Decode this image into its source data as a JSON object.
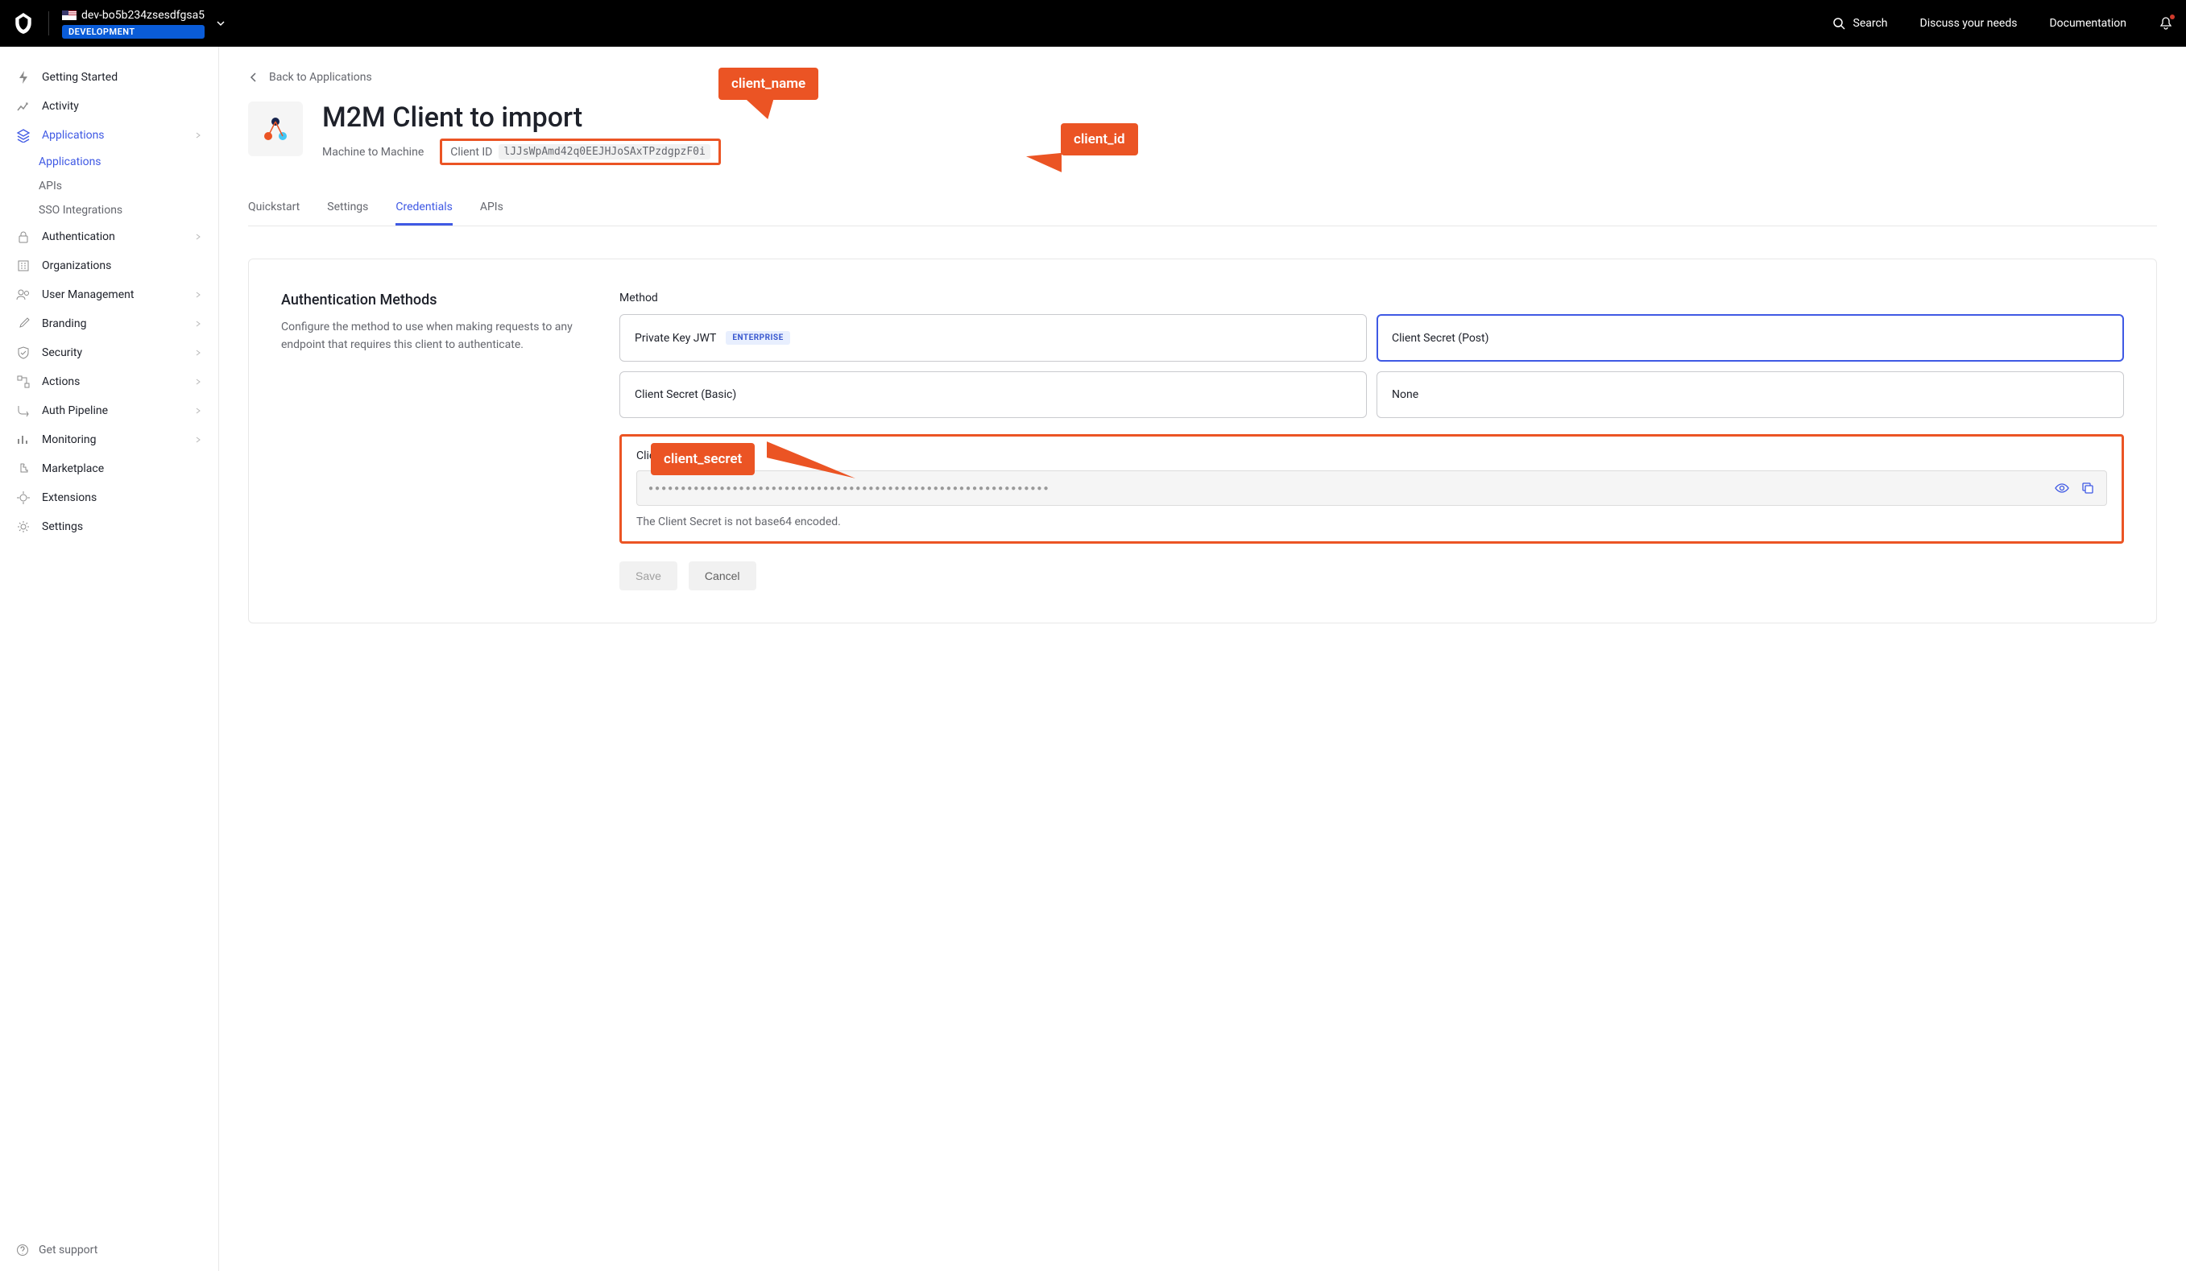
{
  "topbar": {
    "tenant_name": "dev-bo5b234zsesdfgsa5",
    "env_badge": "DEVELOPMENT",
    "search_label": "Search",
    "discuss_label": "Discuss your needs",
    "docs_label": "Documentation"
  },
  "sidebar": {
    "items": [
      {
        "label": "Getting Started",
        "icon": "bolt"
      },
      {
        "label": "Activity",
        "icon": "chart"
      },
      {
        "label": "Applications",
        "icon": "layers",
        "active": true,
        "expandable": true
      },
      {
        "label": "Authentication",
        "icon": "lock",
        "expandable": true
      },
      {
        "label": "Organizations",
        "icon": "building"
      },
      {
        "label": "User Management",
        "icon": "users",
        "expandable": true
      },
      {
        "label": "Branding",
        "icon": "brush",
        "expandable": true
      },
      {
        "label": "Security",
        "icon": "shield",
        "expandable": true
      },
      {
        "label": "Actions",
        "icon": "flow",
        "expandable": true
      },
      {
        "label": "Auth Pipeline",
        "icon": "pipe",
        "expandable": true
      },
      {
        "label": "Monitoring",
        "icon": "bars",
        "expandable": true
      },
      {
        "label": "Marketplace",
        "icon": "puzzle"
      },
      {
        "label": "Extensions",
        "icon": "plug"
      },
      {
        "label": "Settings",
        "icon": "gear"
      }
    ],
    "sub_applications": [
      {
        "label": "Applications",
        "active": true
      },
      {
        "label": "APIs"
      },
      {
        "label": "SSO Integrations"
      }
    ],
    "support_label": "Get support"
  },
  "page": {
    "back_label": "Back to Applications",
    "app_name": "M2M Client to import",
    "app_type": "Machine to Machine",
    "client_id_label": "Client ID",
    "client_id_value": "lJJsWpAmd42q0EEJHJoSAxTPzdgpzF0i",
    "tabs": [
      {
        "label": "Quickstart"
      },
      {
        "label": "Settings"
      },
      {
        "label": "Credentials",
        "active": true
      },
      {
        "label": "APIs"
      }
    ]
  },
  "panel": {
    "title": "Authentication Methods",
    "desc": "Configure the method to use when making requests to any endpoint that requires this client to authenticate.",
    "method_label": "Method",
    "methods": [
      {
        "label": "Private Key JWT",
        "badge": "ENTERPRISE"
      },
      {
        "label": "Client Secret (Post)",
        "selected": true
      },
      {
        "label": "Client Secret (Basic)"
      },
      {
        "label": "None"
      }
    ],
    "secret_label": "Client Secret",
    "secret_masked": "●●●●●●●●●●●●●●●●●●●●●●●●●●●●●●●●●●●●●●●●●●●●●●●●●●●●●●●●●●●●●●",
    "secret_hint": "The Client Secret is not base64 encoded.",
    "save_label": "Save",
    "cancel_label": "Cancel"
  },
  "callouts": {
    "name": "client_name",
    "id": "client_id",
    "secret": "client_secret"
  }
}
